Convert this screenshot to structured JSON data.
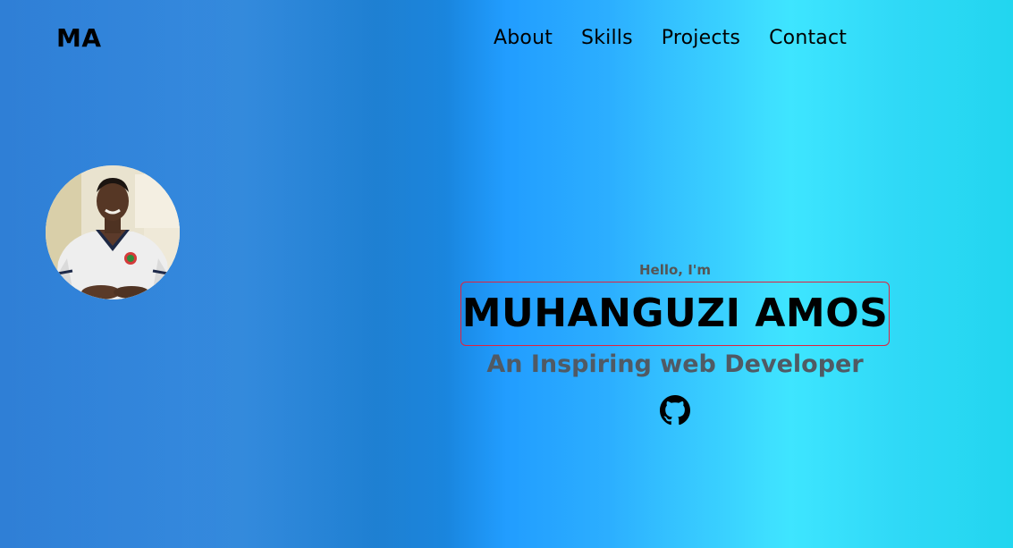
{
  "header": {
    "logo": "MA",
    "nav": [
      {
        "label": "About"
      },
      {
        "label": "Skills"
      },
      {
        "label": "Projects"
      },
      {
        "label": "Contact"
      }
    ]
  },
  "profile": {
    "avatar_icon": "person-photo"
  },
  "hero": {
    "greeting": "Hello, I'm",
    "name": "MUHANGUZI AMOS",
    "tagline": "An Inspiring web Developer",
    "social_icons": [
      "github-icon"
    ]
  },
  "colors": {
    "text_primary": "#000000",
    "text_secondary": "#505a64",
    "name_border": "#e0233f",
    "gradient_start": "#2f7fd6",
    "gradient_mid": "#1f9cff",
    "gradient_end": "#22d6ef"
  }
}
